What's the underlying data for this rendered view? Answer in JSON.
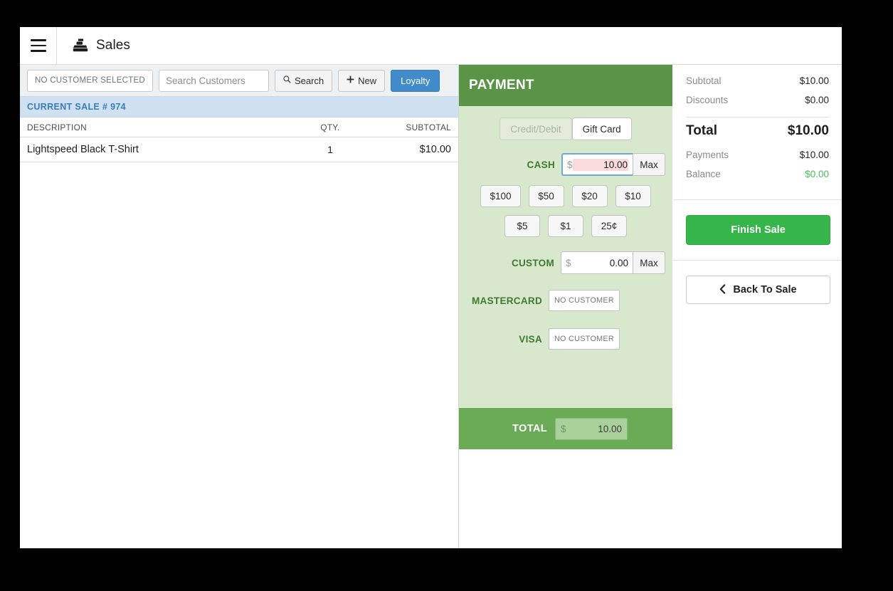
{
  "header": {
    "menu_icon": "hamburger-menu-icon",
    "app_icon": "cash-register-icon",
    "title": "Sales"
  },
  "customer_toolbar": {
    "customer_badge": "NO CUSTOMER SELECTED",
    "search_placeholder": "Search Customers",
    "search_value": "",
    "search_button": "Search",
    "search_icon": "magnifier-icon",
    "new_button": "New",
    "new_icon": "plus-icon",
    "loyalty_button": "Loyalty",
    "loyalty_color": "#428bca"
  },
  "sale": {
    "banner": "CURRENT SALE # 974",
    "columns": [
      "DESCRIPTION",
      "QTY.",
      "SUBTOTAL"
    ],
    "rows": [
      {
        "description": "Lightspeed Black T-Shirt",
        "qty": "1",
        "subtotal": "$10.00"
      }
    ]
  },
  "payment": {
    "title": "PAYMENT",
    "header_color": "#5a9447",
    "body_color": "#d8e8cc",
    "tabs": [
      {
        "label": "Credit/Debit",
        "disabled": true
      },
      {
        "label": "Gift Card",
        "disabled": false
      }
    ],
    "cash": {
      "label": "CASH",
      "currency": "$",
      "value": "10.00",
      "selected": true,
      "max_label": "Max"
    },
    "denominations_row1": [
      "$100",
      "$50",
      "$20",
      "$10"
    ],
    "denominations_row2": [
      "$5",
      "$1",
      "25¢"
    ],
    "custom": {
      "label": "CUSTOM",
      "currency": "$",
      "value": "0.00",
      "max_label": "Max"
    },
    "mastercard": {
      "label": "MASTERCARD",
      "value": "NO CUSTOMER"
    },
    "visa": {
      "label": "VISA",
      "value": "NO CUSTOMER"
    },
    "total": {
      "label": "TOTAL",
      "currency": "$",
      "value": "10.00",
      "bar_color": "#6aab56"
    }
  },
  "summary": {
    "subtotal_label": "Subtotal",
    "subtotal_value": "$10.00",
    "discounts_label": "Discounts",
    "discounts_value": "$0.00",
    "total_label": "Total",
    "total_value": "$10.00",
    "payments_label": "Payments",
    "payments_value": "$10.00",
    "balance_label": "Balance",
    "balance_value": "$0.00",
    "balance_color": "#4cbb5c",
    "finish_sale_label": "Finish Sale",
    "finish_sale_color": "#36b54a",
    "back_to_sale_label": "Back To Sale",
    "back_icon": "chevron-left-icon"
  }
}
